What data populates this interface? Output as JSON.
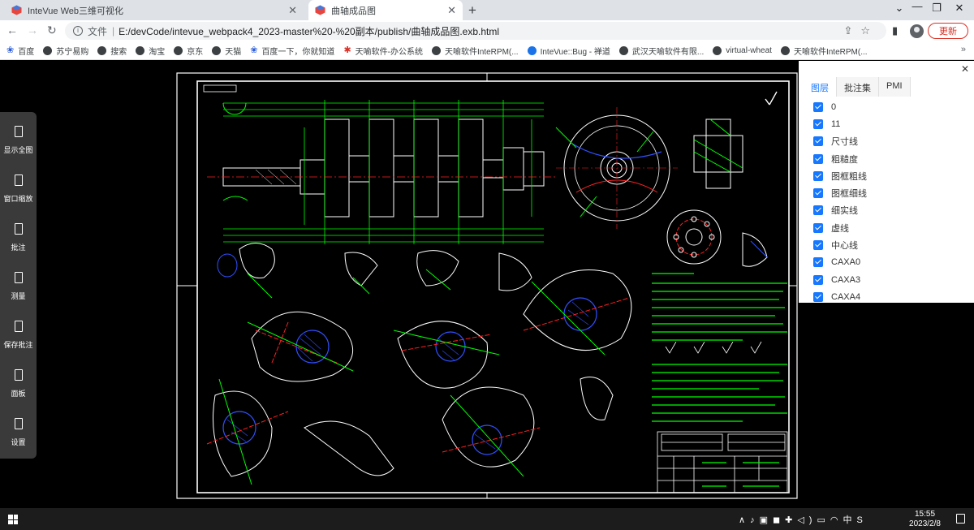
{
  "browser": {
    "tabs": [
      {
        "title": "InteVue Web三维可视化",
        "active": false
      },
      {
        "title": "曲轴成品图",
        "active": true
      }
    ],
    "address": {
      "scheme_label": "文件",
      "url": "E:/devCode/intevue_webpack4_2023-master%20-%20副本/publish/曲轴成品图.exb.html"
    },
    "update_label": "更新",
    "bookmarks": [
      {
        "label": "百度",
        "icon": "baidu-icon"
      },
      {
        "label": "苏宁易购",
        "icon": "globe-icon"
      },
      {
        "label": "搜索",
        "icon": "globe-icon"
      },
      {
        "label": "淘宝",
        "icon": "globe-icon"
      },
      {
        "label": "京东",
        "icon": "globe-icon"
      },
      {
        "label": "天猫",
        "icon": "globe-icon"
      },
      {
        "label": "百度一下，你就知道",
        "icon": "baidu-icon"
      },
      {
        "label": "天喻软件-办公系统",
        "icon": "red-app-icon"
      },
      {
        "label": "天喻软件InteRPM(...",
        "icon": "globe-icon"
      },
      {
        "label": "InteVue::Bug - 禅道",
        "icon": "blue-app-icon"
      },
      {
        "label": "武汉天喻软件有限...",
        "icon": "globe-icon"
      },
      {
        "label": "virtual-wheat",
        "icon": "globe-icon"
      },
      {
        "label": "天喻软件InteRPM(...",
        "icon": "globe-icon"
      }
    ]
  },
  "tools": [
    {
      "label": "显示全图",
      "icon": "fit-all-icon"
    },
    {
      "label": "窗口缩放",
      "icon": "window-zoom-icon"
    },
    {
      "label": "批注",
      "icon": "annotate-icon"
    },
    {
      "label": "测量",
      "icon": "measure-icon"
    },
    {
      "label": "保存批注",
      "icon": "save-annotation-icon"
    },
    {
      "label": "面板",
      "icon": "panel-icon"
    },
    {
      "label": "设置",
      "icon": "settings-icon"
    }
  ],
  "panel": {
    "tabs": [
      {
        "label": "图层",
        "active": true
      },
      {
        "label": "批注集",
        "active": false
      },
      {
        "label": "PMI",
        "active": false
      }
    ],
    "layers": [
      {
        "name": "0",
        "checked": true
      },
      {
        "name": "11",
        "checked": true
      },
      {
        "name": "尺寸线",
        "checked": true
      },
      {
        "name": "粗糙度",
        "checked": true
      },
      {
        "name": "图框粗线",
        "checked": true
      },
      {
        "name": "图框细线",
        "checked": true
      },
      {
        "name": "细实线",
        "checked": true
      },
      {
        "name": "虚线",
        "checked": true
      },
      {
        "name": "中心线",
        "checked": true
      },
      {
        "name": "CAXA0",
        "checked": true
      },
      {
        "name": "CAXA3",
        "checked": true
      },
      {
        "name": "CAXA4",
        "checked": true
      }
    ]
  },
  "taskbar": {
    "ime_label": "中",
    "time": "15:55",
    "date": "2023/2/8"
  },
  "colors": {
    "accent": "#1677ff",
    "update": "#d93025",
    "cad_green": "#00ff00",
    "cad_red": "#ff2020",
    "cad_blue": "#3050ff"
  }
}
